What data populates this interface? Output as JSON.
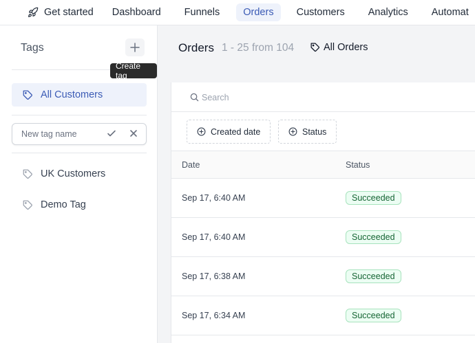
{
  "nav": {
    "items": [
      {
        "label": "Get started",
        "icon": "rocket-icon"
      },
      {
        "label": "Dashboard"
      },
      {
        "label": "Funnels"
      },
      {
        "label": "Orders",
        "active": true
      },
      {
        "label": "Customers"
      },
      {
        "label": "Analytics"
      },
      {
        "label": "Automat"
      }
    ]
  },
  "sidebar": {
    "title": "Tags",
    "add_tooltip": "Create tag",
    "tags": [
      {
        "label": "All Customers",
        "active": true
      },
      {
        "label": "UK Customers"
      },
      {
        "label": "Demo Tag"
      }
    ],
    "new_tag_placeholder": "New tag name"
  },
  "main": {
    "title": "Orders",
    "count": "1 - 25 from 104",
    "filter_label": "All Orders",
    "search_placeholder": "Search",
    "filters": [
      "Created date",
      "Status"
    ],
    "columns": [
      "Date",
      "Status"
    ],
    "rows": [
      {
        "date": "Sep 17, 6:40 AM",
        "status": "Succeeded"
      },
      {
        "date": "Sep 17, 6:40 AM",
        "status": "Succeeded"
      },
      {
        "date": "Sep 17, 6:38 AM",
        "status": "Succeeded"
      },
      {
        "date": "Sep 17, 6:34 AM",
        "status": "Succeeded"
      }
    ]
  },
  "colors": {
    "accent": "#3b5bb5",
    "active_bg": "#eef2fb",
    "success_bg": "#ecfdf3",
    "success_text": "#166534"
  }
}
